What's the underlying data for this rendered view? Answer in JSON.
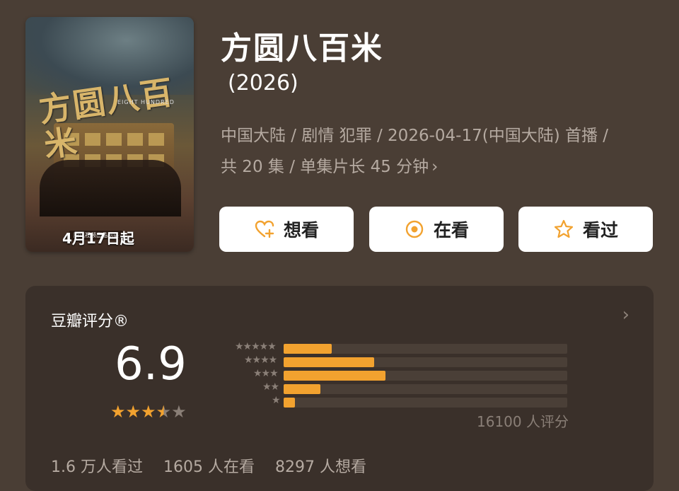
{
  "poster": {
    "title_art": "方圆八百米",
    "english_title": "EIGHT HUNDRED",
    "tag": "腾讯视频出品剧集",
    "release_date": "4月17日起"
  },
  "title": "方圆八百米",
  "year": "(2026)",
  "meta": {
    "line1": "中国大陆 / 剧情 犯罪 / 2026-04-17(中国大陆) 首播 /",
    "line2": "共 20 集 / 单集片长 45 分钟"
  },
  "actions": [
    {
      "label": "想看",
      "icon": "heart-plus-icon"
    },
    {
      "label": "在看",
      "icon": "target-circle-icon"
    },
    {
      "label": "看过",
      "icon": "star-outline-icon"
    }
  ],
  "rating": {
    "label": "豆瓣评分®",
    "score": "6.9",
    "stars_value": 3.5,
    "distribution": [
      {
        "stars": 5,
        "percent": 17
      },
      {
        "stars": 4,
        "percent": 32
      },
      {
        "stars": 3,
        "percent": 36
      },
      {
        "stars": 2,
        "percent": 13
      },
      {
        "stars": 1,
        "percent": 4
      }
    ],
    "count_text": "16100 人评分"
  },
  "stats": {
    "watched": "1.6 万人看过",
    "watching": "1605 人在看",
    "want": "8297 人想看"
  },
  "colors": {
    "background": "#4a3e35",
    "card": "#3a302a",
    "accent": "#f2a22f"
  }
}
